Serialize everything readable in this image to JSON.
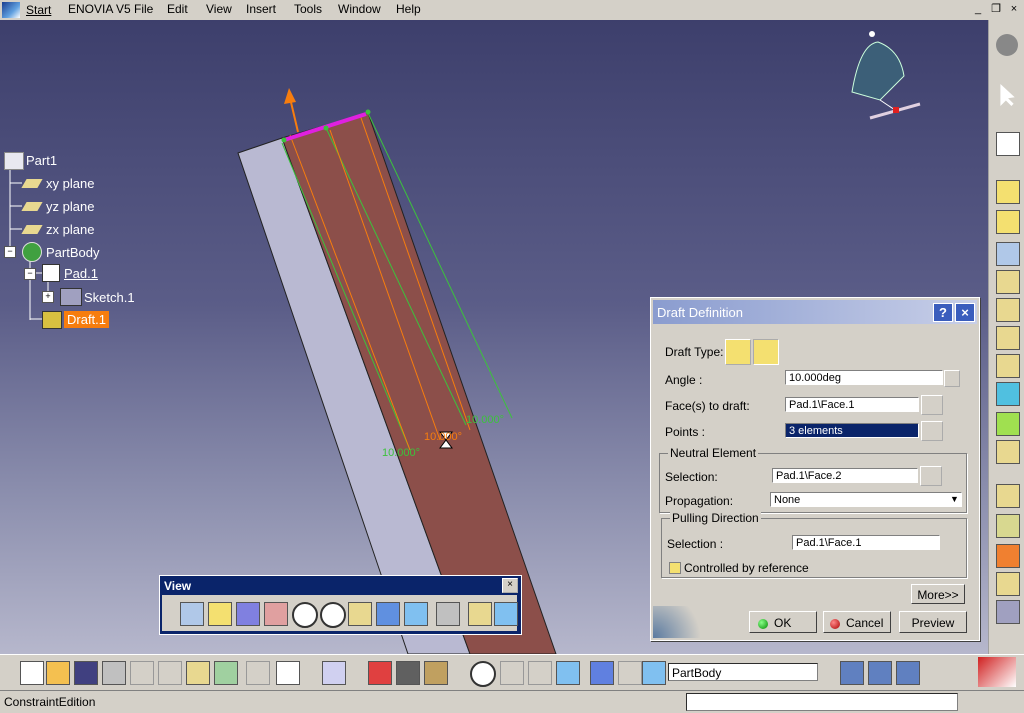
{
  "menubar": {
    "start_label": "Start",
    "items": [
      "ENOVIA V5",
      "File",
      "Edit",
      "View",
      "Insert",
      "Tools",
      "Window",
      "Help"
    ]
  },
  "window_controls": {
    "minimize": "_",
    "restore": "❐",
    "close": "×"
  },
  "tree": {
    "root": "Part1",
    "planes": [
      "xy plane",
      "yz plane",
      "zx plane"
    ],
    "body": "PartBody",
    "pad": "Pad.1",
    "sketch": "Sketch.1",
    "draft": "Draft.1"
  },
  "annotations": {
    "dim_right": "10.000°",
    "dim_left": "10.000°",
    "dim_center": "10.000°"
  },
  "view_toolbar": {
    "title": "View",
    "close": "×"
  },
  "dialog": {
    "title": "Draft Definition",
    "help": "?",
    "close": "×",
    "draft_type_label": "Draft Type:",
    "angle_label": "Angle :",
    "angle_value": "10.000deg",
    "faces_label": "Face(s) to draft:",
    "faces_value": "Pad.1\\Face.1",
    "points_label": "Points :",
    "points_value": "3 elements",
    "neutral_title": "Neutral Element",
    "neutral_selection_label": "Selection:",
    "neutral_selection_value": "Pad.1\\Face.2",
    "propagation_label": "Propagation:",
    "propagation_value": "None",
    "pulling_title": "Pulling Direction",
    "pulling_selection_label": "Selection :",
    "pulling_selection_value": "Pad.1\\Face.1",
    "controlled_label": "Controlled by reference",
    "more": "More>>",
    "ok": "OK",
    "cancel": "Cancel",
    "preview": "Preview"
  },
  "bottom_toolbar": {
    "current_body": "PartBody"
  },
  "status": {
    "text": "ConstraintEdition"
  },
  "colors": {
    "accent": "#0a246a",
    "highlight": "#f77d0e",
    "face": "#8c4f4a",
    "side": "#b9b9d2"
  }
}
